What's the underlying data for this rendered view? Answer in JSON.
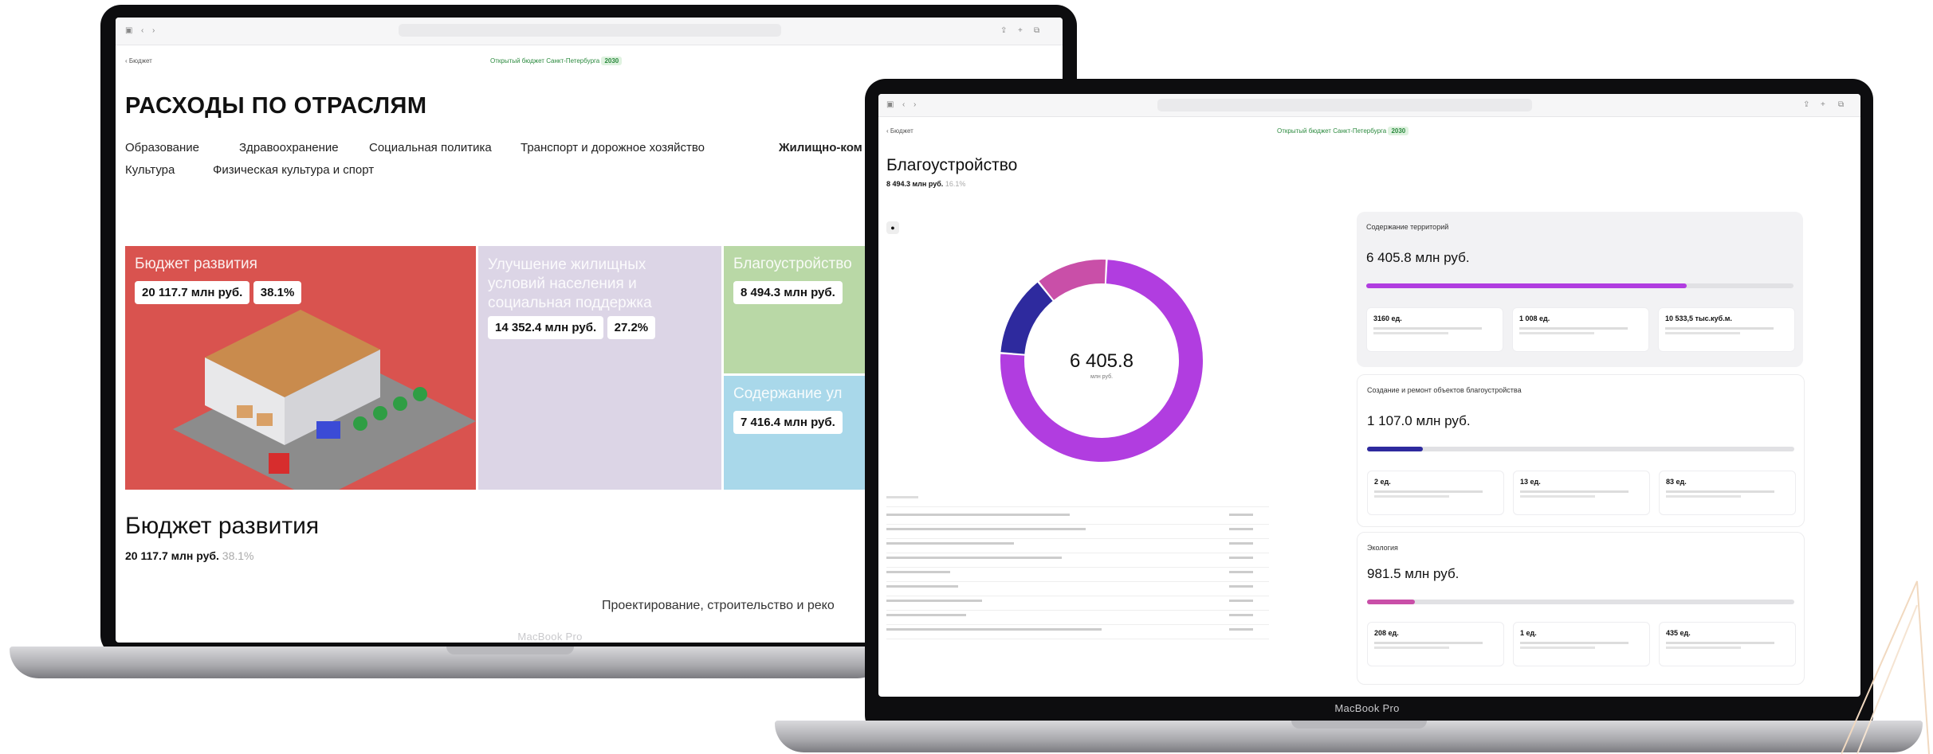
{
  "left_laptop": {
    "model_label": "MacBook Pro",
    "site_top": {
      "back_label": "Бюджет",
      "center_banner": "Открытый бюджет Санкт-Петербурга",
      "center_year": "2030"
    },
    "page_title": "РАСХОДЫ ПО ОТРАСЛЯМ",
    "tabs": [
      "Образование",
      "Здравоохранение",
      "Социальная политика",
      "Транспорт и дорожное хозяйство",
      "Жилищно-ком",
      "Культура",
      "Физическая культура и спорт"
    ],
    "tiles": [
      {
        "title": "Бюджет развития",
        "amount": "20 117.7 млн руб.",
        "percent": "38.1%",
        "color": "#d9534f"
      },
      {
        "title": "Улучшение жилищных условий населения и социальная поддержка",
        "amount": "14 352.4 млн руб.",
        "percent": "27.2%",
        "color": "#dcd5e6"
      },
      {
        "title": "Благоустройство",
        "amount": "8 494.3 млн руб.",
        "percent": "",
        "color": "#b9d8a6"
      },
      {
        "title": "Содержание ул",
        "amount": "7 416.4 млн руб.",
        "percent": "",
        "color": "#a9d8ea"
      }
    ],
    "section_title": "Бюджет развития",
    "section_amount": "20 117.7 млн руб.",
    "section_percent": "38.1%",
    "bottom_cut_text": "Проектирование, строительство и реко"
  },
  "right_laptop": {
    "model_label": "MacBook Pro",
    "back_label": "Бюджет",
    "center_banner": "Открытый бюджет Санкт-Петербурга",
    "center_year": "2030",
    "page_title": "Благоустройство",
    "page_amount": "8 494.3 млн руб.",
    "page_percent": "16.1%",
    "donut": {
      "center_value": "6 405.8",
      "center_unit": "млн руб.",
      "segments": [
        {
          "name": "Содержание территорий",
          "value": 6405.8,
          "color": "#b13de0"
        },
        {
          "name": "Создание и ремонт объектов благоустройства",
          "value": 1107.0,
          "color": "#2e2a9e"
        },
        {
          "name": "Экология",
          "value": 981.5,
          "color": "#c94fa8"
        }
      ]
    },
    "cards": [
      {
        "title": "Содержание территорий",
        "amount": "6 405.8 млн руб.",
        "fill": 0.75,
        "color": "#b13de0",
        "stats": [
          "3160 ед.",
          "1 008 ед.",
          "10 533,5 тыс.куб.м."
        ]
      },
      {
        "title": "Создание и ремонт объектов благоустройства",
        "amount": "1 107.0 млн руб.",
        "fill": 0.13,
        "color": "#2e2a9e",
        "stats": [
          "2 ед.",
          "13 ед.",
          "83 ед."
        ]
      },
      {
        "title": "Экология",
        "amount": "981.5 млн руб.",
        "fill": 0.11,
        "color": "#c94fa8",
        "stats": [
          "208 ед.",
          "1 ед.",
          "435 ед."
        ]
      }
    ]
  }
}
